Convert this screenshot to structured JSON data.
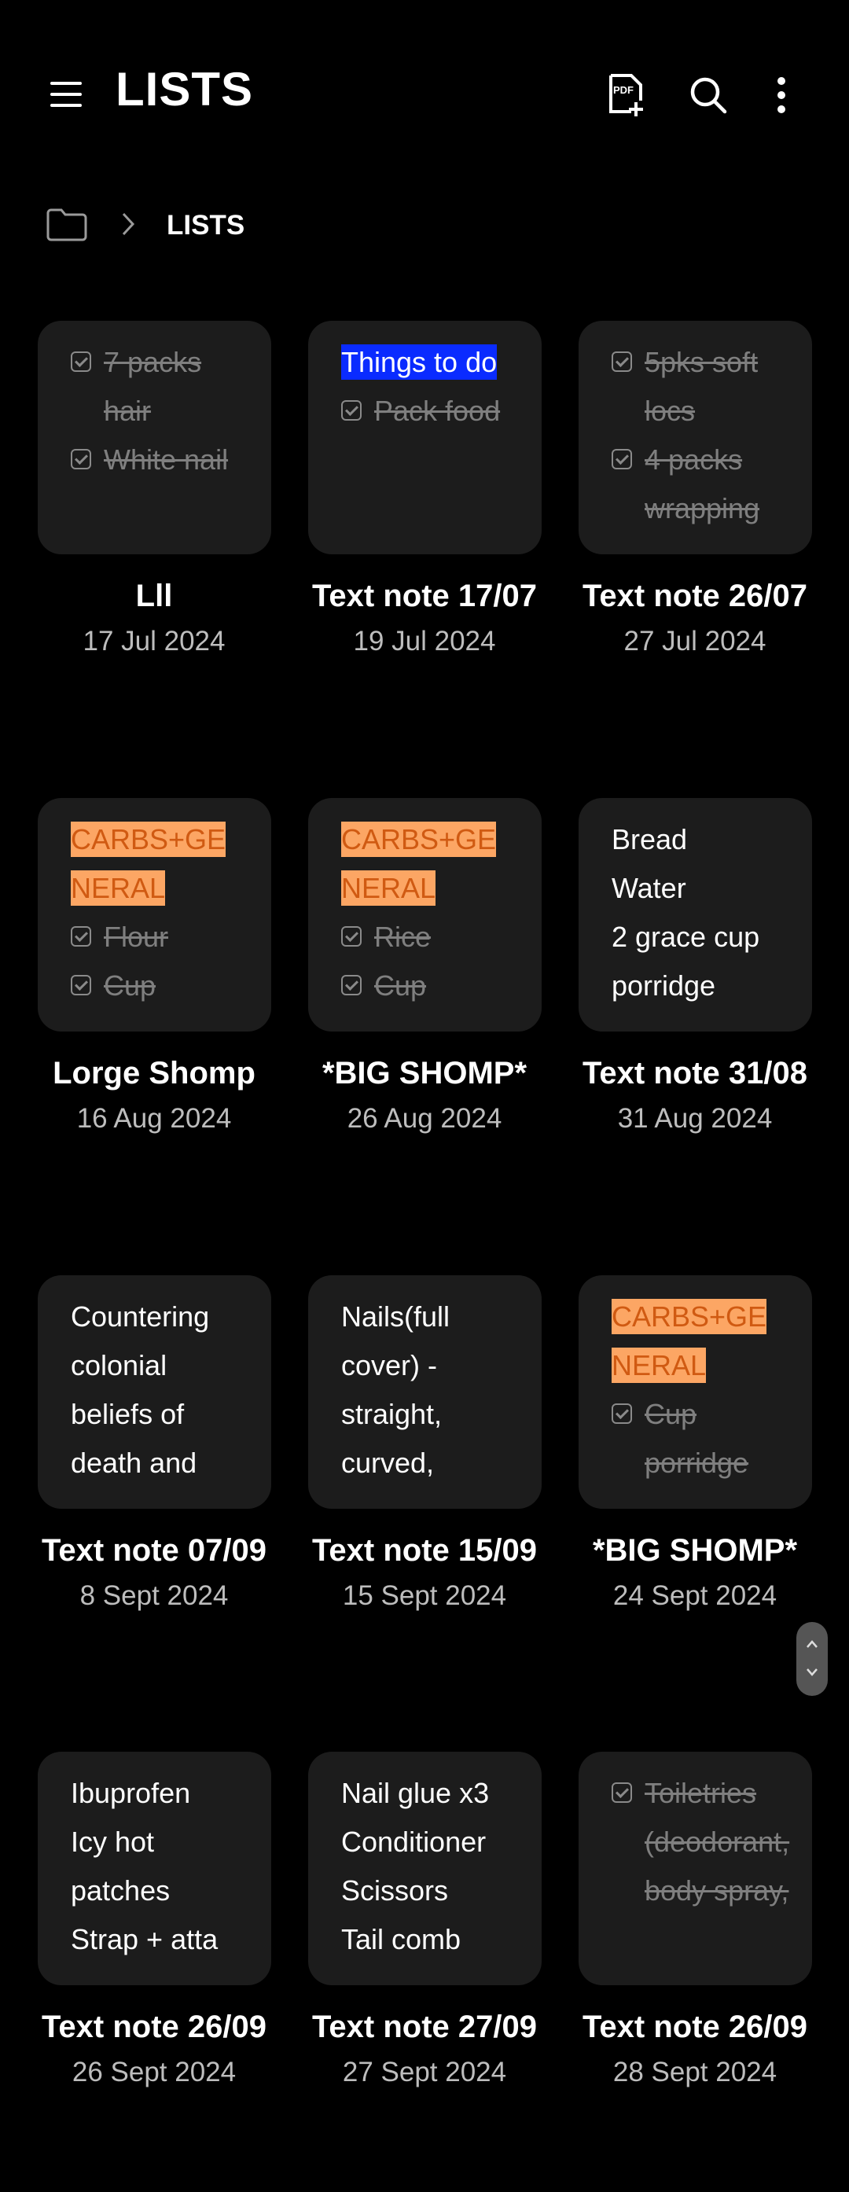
{
  "header": {
    "title": "LISTS",
    "icons": [
      "menu-icon",
      "pdf-add-icon",
      "search-icon",
      "more-vert-icon"
    ]
  },
  "breadcrumb": {
    "label": "LISTS"
  },
  "notes": [
    {
      "title": "Lll",
      "date": "17 Jul 2024",
      "preview": [
        {
          "type": "check",
          "text": "7 packs hair"
        },
        {
          "type": "check",
          "text": "White nail"
        }
      ]
    },
    {
      "title": "Text note 17/07",
      "date": "19 Jul 2024",
      "preview": [
        {
          "type": "hl-blue",
          "text": "Things to do"
        },
        {
          "type": "check",
          "text": "Pack food"
        }
      ]
    },
    {
      "title": "Text note 26/07",
      "date": "27 Jul 2024",
      "preview": [
        {
          "type": "check",
          "text": "5pks soft locs"
        },
        {
          "type": "check",
          "text": "4 packs wrapping"
        }
      ]
    },
    {
      "title": "Lorge Shomp",
      "date": "16 Aug 2024",
      "preview": [
        {
          "type": "hl-orange",
          "text": "CARBS+GENERAL"
        },
        {
          "type": "check",
          "text": "Flour"
        },
        {
          "type": "check",
          "text": "Cup"
        }
      ]
    },
    {
      "title": "*BIG SHOMP*",
      "date": "26 Aug 2024",
      "preview": [
        {
          "type": "hl-orange",
          "text": "CARBS+GENERAL"
        },
        {
          "type": "check",
          "text": "Rice"
        },
        {
          "type": "check",
          "text": "Cup"
        }
      ]
    },
    {
      "title": "Text note 31/08",
      "date": "31 Aug 2024",
      "preview": [
        {
          "type": "text",
          "text": "Bread"
        },
        {
          "type": "text",
          "text": "Water"
        },
        {
          "type": "text",
          "text": "2 grace cup"
        },
        {
          "type": "text",
          "text": "porridge"
        }
      ]
    },
    {
      "title": "Text note 07/09",
      "date": "8 Sept 2024",
      "preview": [
        {
          "type": "text",
          "text": "Countering"
        },
        {
          "type": "text",
          "text": "colonial"
        },
        {
          "type": "text",
          "text": "beliefs of"
        },
        {
          "type": "text",
          "text": "death and"
        }
      ]
    },
    {
      "title": "Text note 15/09",
      "date": "15 Sept 2024",
      "preview": [
        {
          "type": "text",
          "text": "Nails(full"
        },
        {
          "type": "text",
          "text": "cover) -"
        },
        {
          "type": "text",
          "text": "straight,"
        },
        {
          "type": "text",
          "text": "curved,"
        }
      ]
    },
    {
      "title": "*BIG SHOMP*",
      "date": "24 Sept 2024",
      "preview": [
        {
          "type": "hl-orange",
          "text": "CARBS+GENERAL"
        },
        {
          "type": "check",
          "text": "Cup porridge"
        }
      ]
    },
    {
      "title": "Text note 26/09",
      "date": "26 Sept 2024",
      "preview": [
        {
          "type": "text",
          "text": "Ibuprofen"
        },
        {
          "type": "text",
          "text": "Icy hot"
        },
        {
          "type": "text",
          "text": "patches"
        },
        {
          "type": "text",
          "text": "Strap + atta"
        }
      ]
    },
    {
      "title": "Text note 27/09",
      "date": "27 Sept 2024",
      "preview": [
        {
          "type": "text",
          "text": "Nail glue x3"
        },
        {
          "type": "text",
          "text": "Conditioner"
        },
        {
          "type": "text",
          "text": "Scissors"
        },
        {
          "type": "text",
          "text": "Tail comb"
        }
      ]
    },
    {
      "title": "Text note 26/09",
      "date": "28 Sept 2024",
      "preview": [
        {
          "type": "check",
          "text": "Toiletries (deodorant, body spray,"
        }
      ]
    }
  ]
}
